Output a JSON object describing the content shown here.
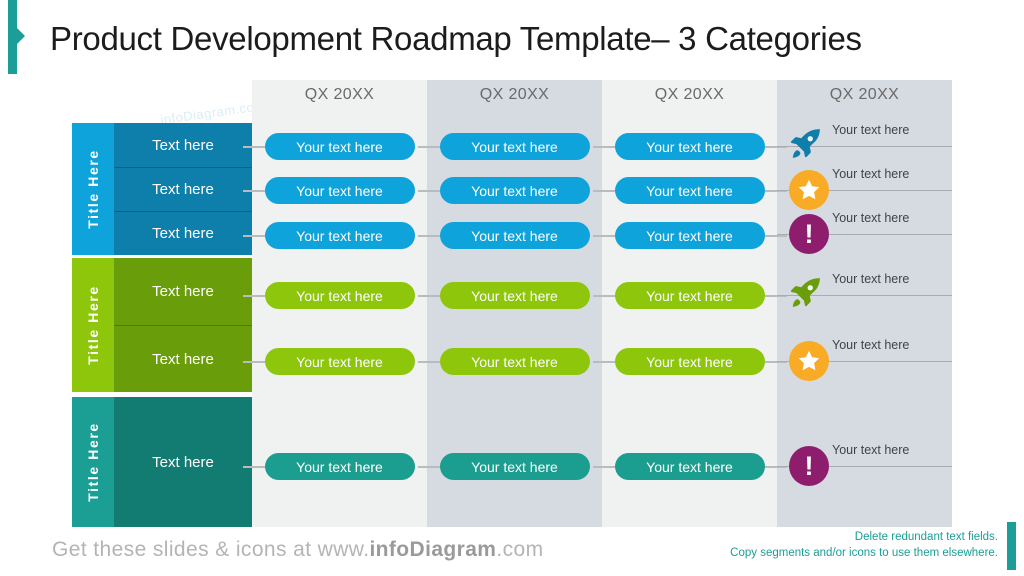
{
  "slide": {
    "title": "Product Development Roadmap Template– 3 Categories",
    "watermark": "infoDiagram.com"
  },
  "columns": [
    {
      "label": "QX 20XX",
      "shade": "light"
    },
    {
      "label": "QX 20XX",
      "shade": "dark"
    },
    {
      "label": "QX 20XX",
      "shade": "light"
    },
    {
      "label": "QX 20XX",
      "shade": "dark"
    }
  ],
  "categories": [
    {
      "side_label": "Title Here",
      "side_color": "#0fa3dc",
      "body_color": "#0e7eab",
      "pill_color": "#0fa3dc",
      "rows": [
        {
          "text": "Text here",
          "pills": [
            "Your text here",
            "Your text here",
            "Your text here"
          ]
        },
        {
          "text": "Text here",
          "pills": [
            "Your text here",
            "Your text here",
            "Your text here"
          ]
        },
        {
          "text": "Text here",
          "pills": [
            "Your text here",
            "Your text here",
            "Your text here"
          ]
        }
      ]
    },
    {
      "side_label": "Title Here",
      "side_color": "#8dc60b",
      "body_color": "#6a9d0a",
      "pill_color": "#8dc60b",
      "rows": [
        {
          "text": "Text here",
          "pills": [
            "Your text here",
            "Your text here",
            "Your text here"
          ]
        },
        {
          "text": "Text here",
          "pills": [
            "Your text here",
            "Your text here",
            "Your text here"
          ]
        }
      ]
    },
    {
      "side_label": "Title Here",
      "side_color": "#1b9e94",
      "body_color": "#127c72",
      "pill_color": "#1b9e8f",
      "rows": [
        {
          "text": "Text here",
          "pills": [
            "Your text here",
            "Your text here",
            "Your text here"
          ]
        }
      ]
    }
  ],
  "milestones": [
    {
      "icon": "rocket-icon",
      "color": "#0e7eab",
      "label": "Your text here"
    },
    {
      "icon": "star-circle-icon",
      "color": "#f9ab26",
      "label": "Your text here"
    },
    {
      "icon": "alert-circle-icon",
      "color": "#8e1d6e",
      "label": "Your text here"
    },
    {
      "icon": "rocket-icon",
      "color": "#6a9d0a",
      "label": "Your text here"
    },
    {
      "icon": "star-circle-icon",
      "color": "#f9ab26",
      "label": "Your text here"
    },
    {
      "icon": "alert-circle-icon",
      "color": "#8e1d6e",
      "label": "Your text here"
    }
  ],
  "footer": {
    "prefix": "Get these slides & icons at www.",
    "brand": "infoDiagram",
    "suffix": ".com"
  },
  "note": {
    "line1": "Delete redundant text fields.",
    "line2": "Copy segments and/or icons to use them elsewhere."
  },
  "accent_color": "#1a9e97"
}
